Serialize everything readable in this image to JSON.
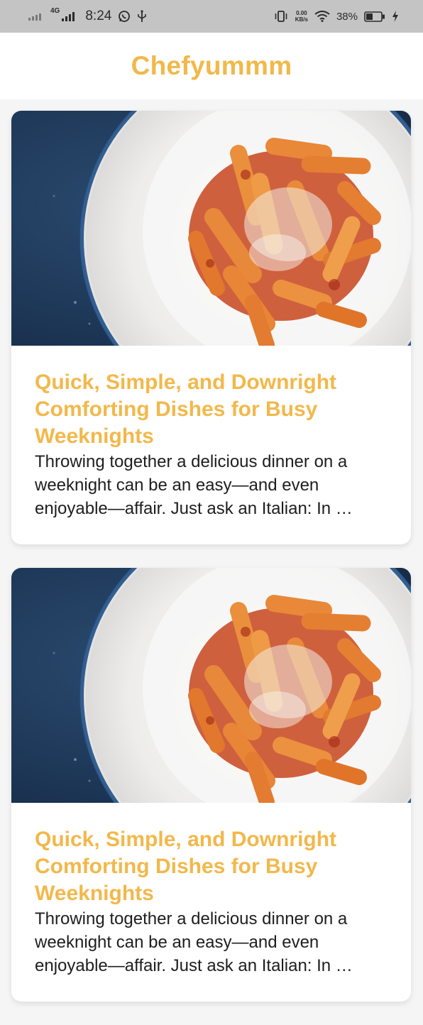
{
  "status_bar": {
    "network_label": "4G",
    "time": "8:24",
    "speed_value": "0.00",
    "speed_unit": "KB/s",
    "battery_percent": "38%",
    "icons": [
      "signal-icon",
      "whatsapp-icon",
      "usb-icon",
      "vibrate-icon",
      "wifi-icon",
      "battery-icon",
      "charging-icon"
    ]
  },
  "app_bar": {
    "title": "Chefyummm"
  },
  "colors": {
    "accent": "#f2b84b",
    "status_bar_bg": "#c4c4c4",
    "text_dark": "#1e1e1e"
  },
  "recipes": [
    {
      "title": "Quick, Simple, and Downright Comforting Dishes for Busy Weeknights",
      "description": "Throwing together a delicious dinner on a weeknight can be an easy—and even enjoyable—affair. Just ask an Italian: In …",
      "image": "pasta-dish-image"
    },
    {
      "title": "Quick, Simple, and Downright Comforting Dishes for Busy Weeknights",
      "description": "Throwing together a delicious dinner on a weeknight can be an easy—and even enjoyable—affair. Just ask an Italian: In …",
      "image": "pasta-dish-image"
    }
  ]
}
